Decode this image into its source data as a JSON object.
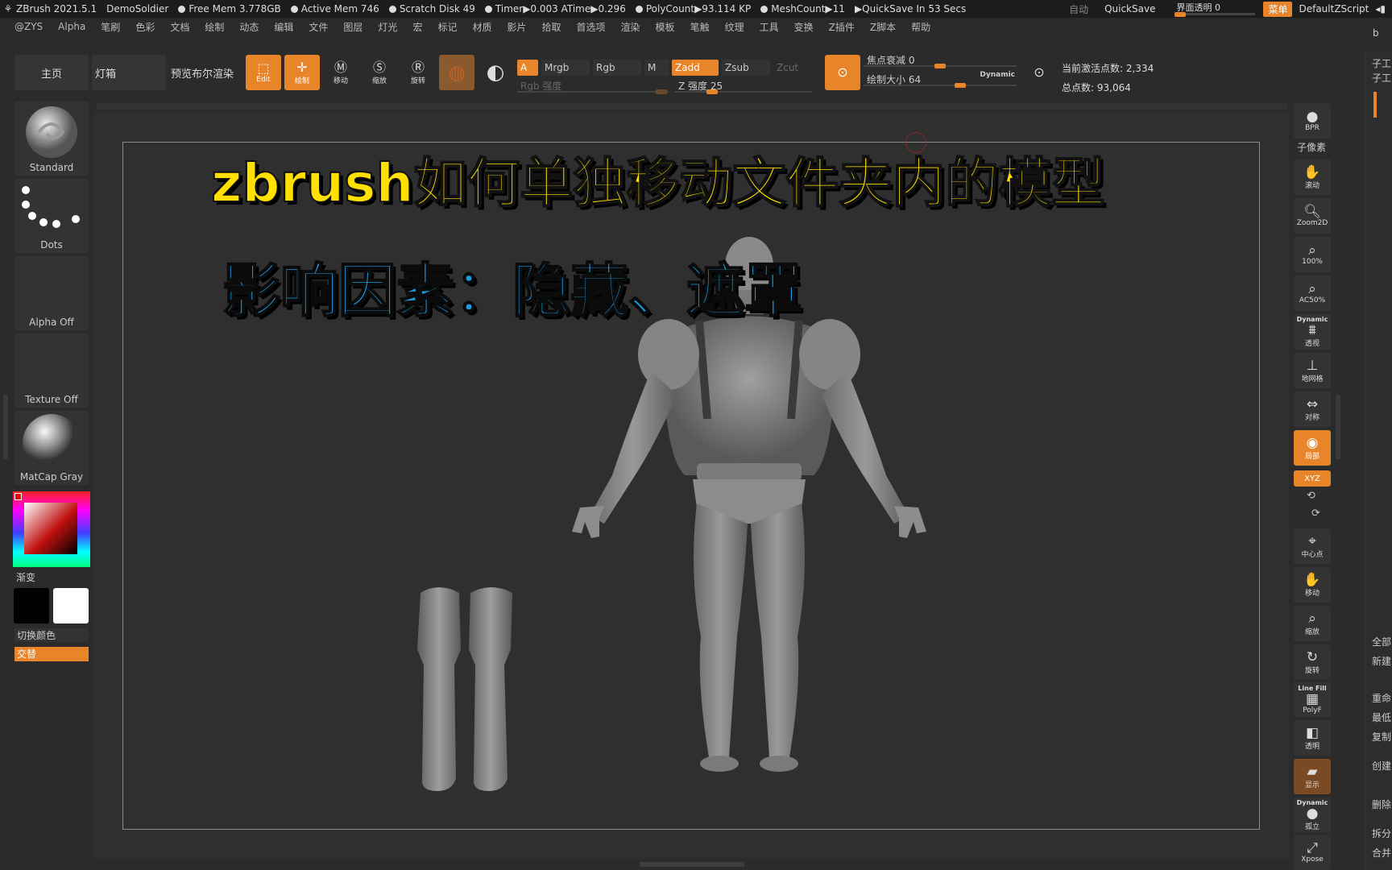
{
  "titlebar": {
    "app": "ZBrush 2021.5.1",
    "project": "DemoSoldier",
    "free_mem": "Free Mem 3.778GB",
    "active_mem": "Active Mem 746",
    "scratch": "Scratch Disk 49",
    "timer": "Timer▶0.003 ATime▶0.296",
    "polycount": "PolyCount▶93.114 KP",
    "meshcount": "MeshCount▶11",
    "quicksave_in": "▶QuickSave In 53 Secs",
    "auto": "自动",
    "quicksave": "QuickSave",
    "transparency": "界面透明 0",
    "menu": "菜单",
    "script": "DefaultZScript"
  },
  "menubar": [
    "@ZYS",
    "Alpha",
    "笔刷",
    "色彩",
    "文档",
    "绘制",
    "动态",
    "编辑",
    "文件",
    "图层",
    "灯光",
    "宏",
    "标记",
    "材质",
    "影片",
    "拾取",
    "首选项",
    "渲染",
    "模板",
    "笔触",
    "纹理",
    "工具",
    "变换",
    "Z插件",
    "Z脚本",
    "帮助"
  ],
  "toolbar": {
    "home": "主页",
    "lightbox": "灯箱",
    "bpr_preview": "预览布尔渲染",
    "edit": "Edit",
    "draw": "绘制",
    "move": "移动",
    "scale": "缩放",
    "rotate": "旋转",
    "a": "A",
    "mrgb": "Mrgb",
    "rgb": "Rgb",
    "m": "M",
    "zadd": "Zadd",
    "zsub": "Zsub",
    "zcut": "Zcut",
    "rgb_intensity": "Rgb 强度",
    "z_intensity": "Z 强度 25",
    "focal_shift": "焦点衰减 0",
    "draw_size": "绘制大小 64",
    "dynamic": "Dynamic",
    "active_points": "当前激活点数: 2,334",
    "total_points": "总点数: 93,064"
  },
  "levels": {
    "z_intensity": 0.25,
    "focal_shift": 0.5,
    "draw_size": 0.64
  },
  "shelf": {
    "brush": "Standard",
    "stroke": "Dots",
    "alpha": "Alpha Off",
    "texture": "Texture Off",
    "material": "MatCap Gray",
    "gradient": "渐变",
    "switch_color": "切换颜色",
    "alternate": "交替"
  },
  "viewport": {
    "title": "zbrush如何单独移动文件夹内的模型",
    "subtitle": "影响因素：隐藏、遮罩"
  },
  "right_shelf": {
    "bpr": "BPR",
    "subpixel": "子像素",
    "scroll": "滚动",
    "zoom2d": "Zoom2D",
    "hundred": "100%",
    "ac50": "AC50%",
    "dynamic_label": "Dynamic",
    "persp": "透视",
    "floor": "地网格",
    "sym": "对称",
    "local": "局部",
    "xyz": "XYZ",
    "center": "中心点",
    "move": "移动",
    "zoom": "缩放",
    "rotate": "旋转",
    "linefill": "Line Fill",
    "polyf": "PolyF",
    "transp": "透明",
    "ghost": "显示",
    "solo_dynamic": "Dynamic",
    "solo": "孤立",
    "xpose": "Xpose"
  },
  "tray": {
    "subtool": "子工",
    "subtool2": "子工",
    "b": "b",
    "all": "全部",
    "new": "新建",
    "rename": "重命",
    "lowest": "最低",
    "copy": "复制",
    "create": "创建",
    "delete": "删除",
    "split": "拆分",
    "merge": "合并"
  },
  "colors": {
    "accent": "#e8852a",
    "title_yellow": "#ffe000",
    "title_blue": "#1e9be0"
  }
}
